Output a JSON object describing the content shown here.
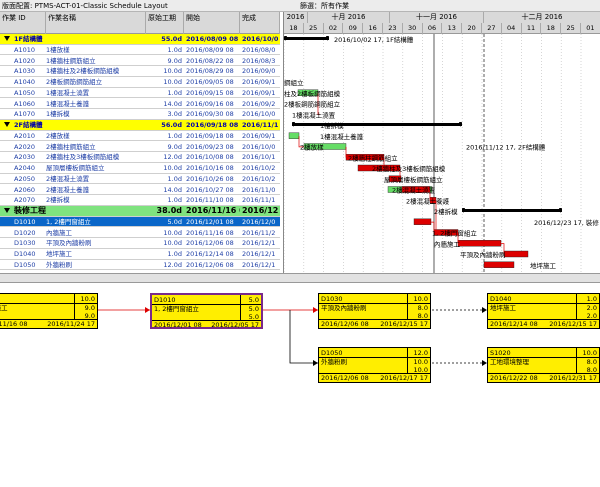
{
  "topbar": {
    "layout_label": "版面配置: PTMS-ACT-01-Classic Schedule Layout",
    "filter_label": "篩選：所有作業"
  },
  "table": {
    "headers": {
      "id": "作業 ID",
      "name": "作業名稱",
      "duration": "原始工期",
      "start": "開始",
      "finish": "完成"
    },
    "rows": [
      {
        "type": "group1",
        "id": "",
        "name": "1F結構體",
        "duration": "55.0d",
        "start": "2016/08/09 08",
        "finish": "2016/10/0"
      },
      {
        "type": "task",
        "id": "A1010",
        "name": "1樓放樣",
        "duration": "1.0d",
        "start": "2016/08/09 08",
        "finish": "2016/08/0"
      },
      {
        "type": "task",
        "id": "A1020",
        "name": "1樓牆柱鋼筋組立",
        "duration": "9.0d",
        "start": "2016/08/22 08",
        "finish": "2016/08/3"
      },
      {
        "type": "task",
        "id": "A1030",
        "name": "1樓牆柱及2樓板鋼筋組模",
        "duration": "10.0d",
        "start": "2016/08/29 08",
        "finish": "2016/09/0"
      },
      {
        "type": "task",
        "id": "A1040",
        "name": "2樓板鋼筋鋼筋組立",
        "duration": "10.0d",
        "start": "2016/09/05 08",
        "finish": "2016/09/1"
      },
      {
        "type": "task",
        "id": "A1050",
        "name": "1樓混凝土澆置",
        "duration": "1.0d",
        "start": "2016/09/15 08",
        "finish": "2016/09/1"
      },
      {
        "type": "task",
        "id": "A1060",
        "name": "1樓混凝土養護",
        "duration": "14.0d",
        "start": "2016/09/16 08",
        "finish": "2016/09/2"
      },
      {
        "type": "task",
        "id": "A1070",
        "name": "1樓拆模",
        "duration": "3.0d",
        "start": "2016/09/30 08",
        "finish": "2016/10/0"
      },
      {
        "type": "group1",
        "id": "",
        "name": "2F結構體",
        "duration": "56.0d",
        "start": "2016/09/18 08",
        "finish": "2016/11/1"
      },
      {
        "type": "task",
        "id": "A2010",
        "name": "2樓放樣",
        "duration": "1.0d",
        "start": "2016/09/18 08",
        "finish": "2016/09/1"
      },
      {
        "type": "task",
        "id": "A2020",
        "name": "2樓牆柱鋼筋組立",
        "duration": "9.0d",
        "start": "2016/09/23 08",
        "finish": "2016/10/0"
      },
      {
        "type": "task",
        "id": "A2030",
        "name": "2樓牆柱及3樓板鋼筋組模",
        "duration": "12.0d",
        "start": "2016/10/08 08",
        "finish": "2016/10/1"
      },
      {
        "type": "task",
        "id": "A2040",
        "name": "屋頂層樓板鋼筋組立",
        "duration": "10.0d",
        "start": "2016/10/16 08",
        "finish": "2016/10/2"
      },
      {
        "type": "task",
        "id": "A2050",
        "name": "2樓混凝土澆置",
        "duration": "1.0d",
        "start": "2016/10/26 08",
        "finish": "2016/10/2"
      },
      {
        "type": "task",
        "id": "A2060",
        "name": "2樓混凝土養護",
        "duration": "14.0d",
        "start": "2016/10/27 08",
        "finish": "2016/11/0"
      },
      {
        "type": "task",
        "id": "A2070",
        "name": "2樓拆模",
        "duration": "1.0d",
        "start": "2016/11/10 08",
        "finish": "2016/11/1"
      },
      {
        "type": "group2",
        "id": "",
        "name": "裝修工程",
        "duration": "38.0d",
        "start": "2016/11/16 08",
        "finish": "2016/12/2"
      },
      {
        "type": "selected",
        "id": "D1010",
        "name": "1, 2樓門窗組立",
        "duration": "5.0d",
        "start": "2016/12/01 08",
        "finish": "2016/12/0"
      },
      {
        "type": "task",
        "id": "D1020",
        "name": "內牆施工",
        "duration": "10.0d",
        "start": "2016/11/16 08",
        "finish": "2016/11/2"
      },
      {
        "type": "task",
        "id": "D1030",
        "name": "平頂及內牆粉刷",
        "duration": "10.0d",
        "start": "2016/12/06 08",
        "finish": "2016/12/1"
      },
      {
        "type": "task",
        "id": "D1040",
        "name": "地坪施工",
        "duration": "1.0d",
        "start": "2016/12/14 08",
        "finish": "2016/12/1"
      },
      {
        "type": "task",
        "id": "D1050",
        "name": "外牆粉刷",
        "duration": "12.0d",
        "start": "2016/12/06 08",
        "finish": "2016/12/1"
      }
    ]
  },
  "gantt": {
    "months": [
      "2016",
      "十月 2016",
      "十一月 2016",
      "十二月 2016"
    ],
    "days": [
      "18",
      "25",
      "02",
      "09",
      "16",
      "23",
      "30",
      "06",
      "13",
      "20",
      "27",
      "04",
      "11",
      "18",
      "25",
      "01"
    ],
    "labels": [
      "2016/10/02 17, 1F結構體",
      "鋼組立",
      "柱及2樓板鋼筋組模",
      "2樓板鋼筋鋼筋組立",
      "1樓混凝土澆置",
      "1樓混凝土養護",
      "1樓拆模",
      "2016/11/12 17, 2F結構體",
      "2樓放樣",
      "2樓牆柱鋼筋組立",
      "2樓牆柱及3樓板鋼筋組模",
      "屋頂層樓板鋼筋組立",
      "2樓混凝土澆置",
      "2樓混凝土養護",
      "2樓拆模",
      "2016/12/23 17, 裝修",
      "1, 2樓門窗組立",
      "內牆施工",
      "平頂及內牆粉刷",
      "地坪施工"
    ]
  },
  "network": {
    "boxes": [
      {
        "id": "20",
        "name": "牆施工",
        "start": "16/11/16 08",
        "finish": "2016/11/24 17",
        "dur_a": "10.0",
        "dur_b": "9.0",
        "dur_c": "9.0"
      },
      {
        "id": "D1010",
        "name": "1, 2樓門窗組立",
        "start": "2016/12/01 08",
        "finish": "2016/12/05 17",
        "dur_a": "5.0",
        "dur_b": "5.0",
        "dur_c": "5.0"
      },
      {
        "id": "D1030",
        "name": "平頂及內牆粉刷",
        "start": "2016/12/06 08",
        "finish": "2016/12/15 17",
        "dur_a": "10.0",
        "dur_b": "8.0",
        "dur_c": "8.0"
      },
      {
        "id": "D1040",
        "name": "地坪施工",
        "start": "2016/12/14 08",
        "finish": "2016/12/15 17",
        "dur_a": "1.0",
        "dur_b": "2.0",
        "dur_c": "2.0"
      },
      {
        "id": "D1050",
        "name": "外牆粉刷",
        "start": "2016/12/06 08",
        "finish": "2016/12/17 17",
        "dur_a": "12.0",
        "dur_b": "10.0",
        "dur_c": "10.0"
      },
      {
        "id": "S1020",
        "name": "工地環境整理",
        "start": "2016/12/22 08",
        "finish": "2016/12/31 17",
        "dur_a": "10.0",
        "dur_b": "8.0",
        "dur_c": "8.0"
      }
    ]
  },
  "colors": {
    "group1": "#ffff00",
    "group2": "#7fe37f",
    "selected": "#0a66c8",
    "bar_green": "#66dd66",
    "bar_red": "#dd0000",
    "summary": "#000000",
    "node": "#ffee00"
  }
}
